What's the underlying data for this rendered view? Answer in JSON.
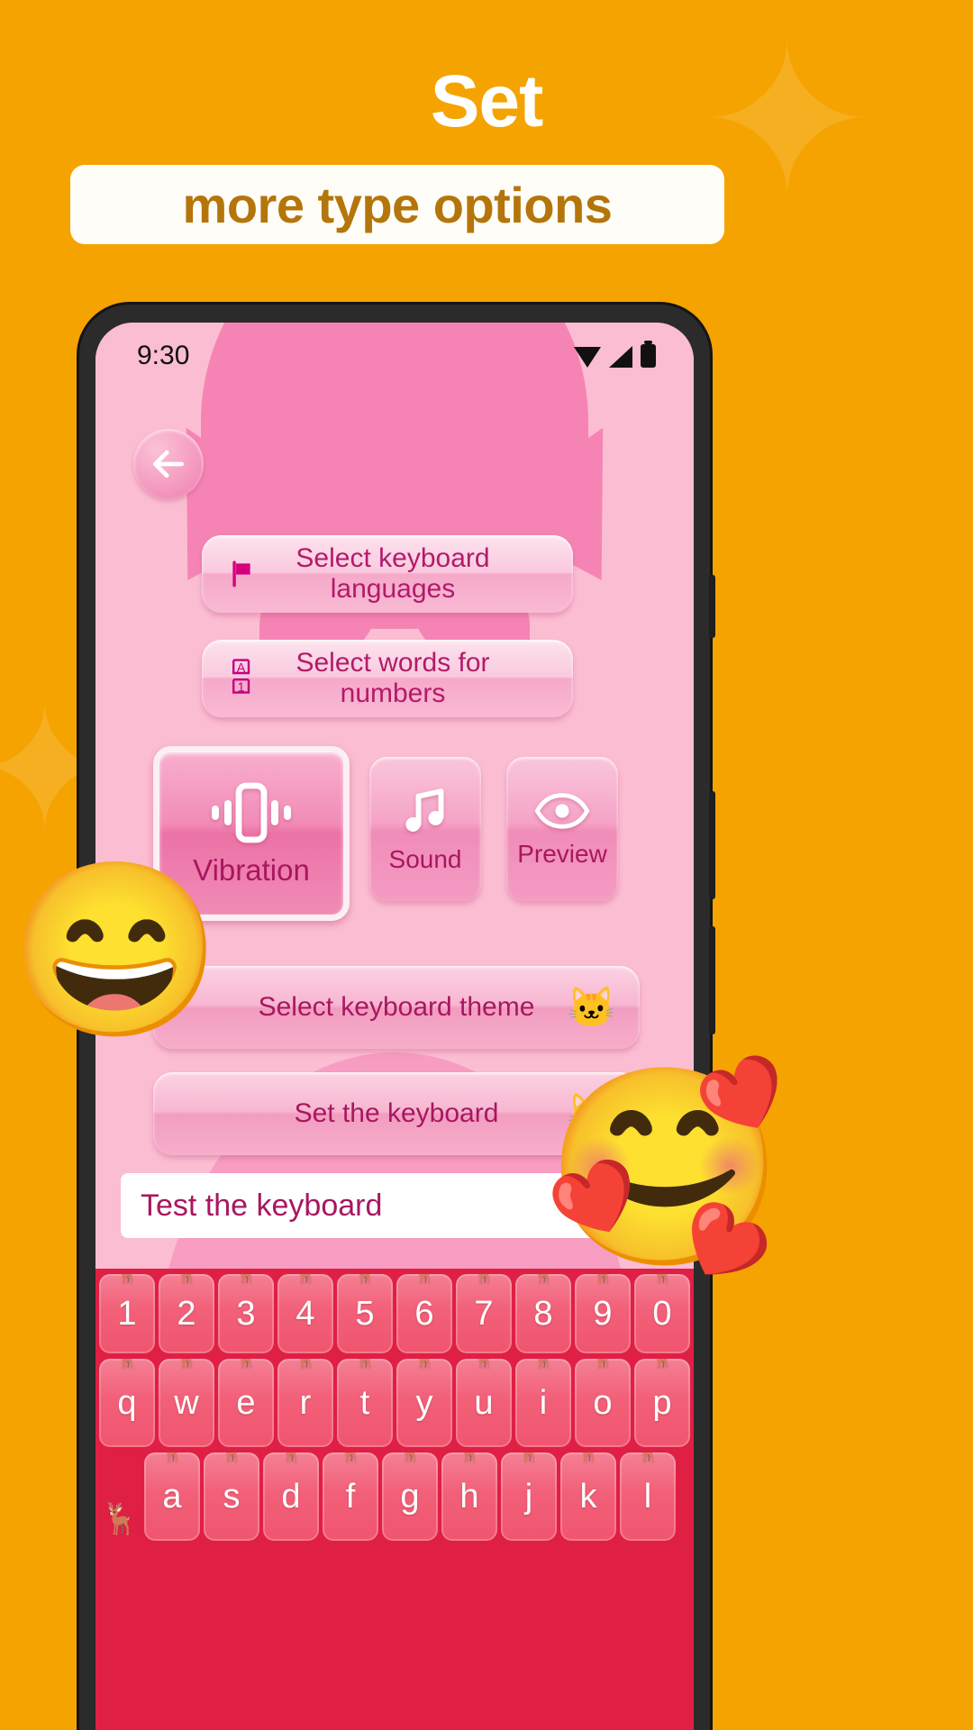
{
  "promo": {
    "headline": "Set",
    "subtitle": "more type options",
    "background_color": "#F5A300",
    "headline_color": "#FFFFFF",
    "subtitle_color": "#B4760B",
    "banner_color": "#FFFDF8"
  },
  "status_bar": {
    "time": "9:30",
    "icons": [
      "wifi-icon",
      "signal-icon",
      "battery-icon"
    ]
  },
  "app": {
    "back_button": "back-arrow-icon",
    "accent_color": "#B31A6A",
    "surface_color": "#FBBDD2",
    "rows": [
      {
        "icon": "flag-icon",
        "label": "Select keyboard languages"
      },
      {
        "icon": "words-for-numbers-icon",
        "label": "Select words for numbers"
      }
    ],
    "tiles": [
      {
        "icon": "vibration-icon",
        "label": "Vibration",
        "selected": true
      },
      {
        "icon": "music-note-icon",
        "label": "Sound",
        "selected": false
      },
      {
        "icon": "eye-icon",
        "label": "Preview",
        "selected": false
      }
    ],
    "wide_rows": [
      {
        "label": "Select keyboard theme",
        "badge": "cat-face-emoji"
      },
      {
        "label": "Set the keyboard",
        "badge": "cat-face-emoji"
      }
    ],
    "test_field": {
      "placeholder": "Test the keyboard",
      "value": "",
      "background": "#FFFFFF"
    }
  },
  "keyboard": {
    "background_color": "#E01F44",
    "key_color": "#F04A66",
    "key_text_color": "#FFFFFF",
    "rows": [
      [
        "1",
        "2",
        "3",
        "4",
        "5",
        "6",
        "7",
        "8",
        "9",
        "0"
      ],
      [
        "q",
        "w",
        "e",
        "r",
        "t",
        "y",
        "u",
        "i",
        "o",
        "p"
      ],
      [
        "a",
        "s",
        "d",
        "f",
        "g",
        "h",
        "j",
        "k",
        "l"
      ]
    ],
    "decoration": "reindeer-pattern"
  },
  "decorations": {
    "floating_emojis": [
      "grinning-squinting-face",
      "smiling-face-with-hearts"
    ],
    "sparkles": 2
  }
}
